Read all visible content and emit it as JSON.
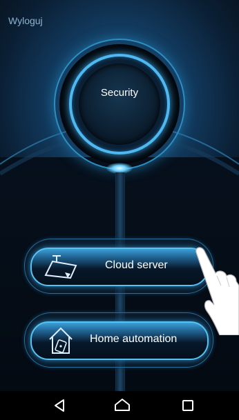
{
  "header": {
    "logout_label": "Wyloguj"
  },
  "security": {
    "label": "Security"
  },
  "menu": {
    "cloud_server": {
      "label": "Cloud server",
      "icon": "cloud-server-icon"
    },
    "home_automation": {
      "label": "Home automation",
      "icon": "home-automation-icon"
    }
  },
  "navbar": {
    "buttons": [
      "back-icon",
      "home-icon",
      "recents-icon"
    ]
  },
  "colors": {
    "accent": "#4fb8f0",
    "background": "#050b14"
  }
}
